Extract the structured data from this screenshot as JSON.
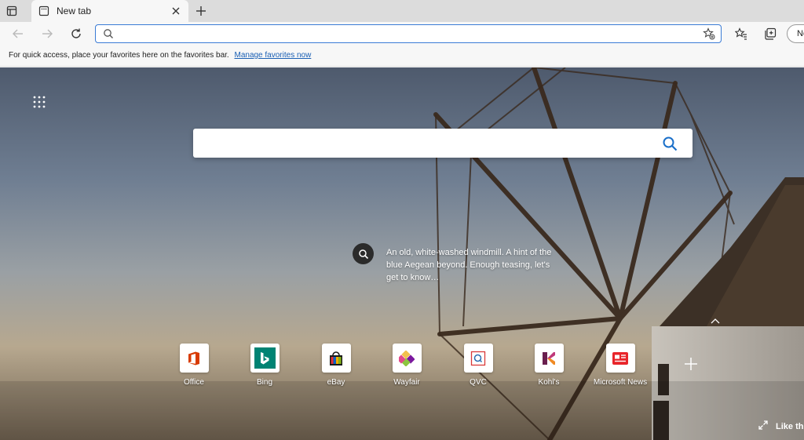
{
  "tab": {
    "title": "New tab",
    "close_icon": "close-icon",
    "favicon": "new-tab-page-icon"
  },
  "toolbar": {
    "omnibox_value": "",
    "omnibox_placeholder": "",
    "profile_label": "No"
  },
  "favorites_bar": {
    "message": "For quick access, place your favorites here on the favorites bar.",
    "link_label": "Manage favorites now"
  },
  "search": {
    "value": "",
    "placeholder": ""
  },
  "image_caption": "An old, white-washed windmill. A hint of the blue Aegean beyond. Enough teasing, let's get to know…",
  "quick_links": [
    {
      "label": "Office",
      "icon": "office-icon",
      "color": "#d83b01"
    },
    {
      "label": "Bing",
      "icon": "bing-icon",
      "color": "#008373"
    },
    {
      "label": "eBay",
      "icon": "ebay-icon",
      "color": "#1a1a1a"
    },
    {
      "label": "Wayfair",
      "icon": "wayfair-icon",
      "color": "#7b189f"
    },
    {
      "label": "QVC",
      "icon": "qvc-icon",
      "color": "#d93a3a"
    },
    {
      "label": "Kohl's",
      "icon": "kohls-icon",
      "color": "#6a1f4f"
    },
    {
      "label": "Microsoft News",
      "icon": "news-icon",
      "color": "#e8252a"
    }
  ],
  "like_label": "Like th",
  "colors": {
    "accent": "#3a7bd5",
    "tabstrip": "#dcdcdc",
    "toolbar": "#f7f7f7"
  }
}
